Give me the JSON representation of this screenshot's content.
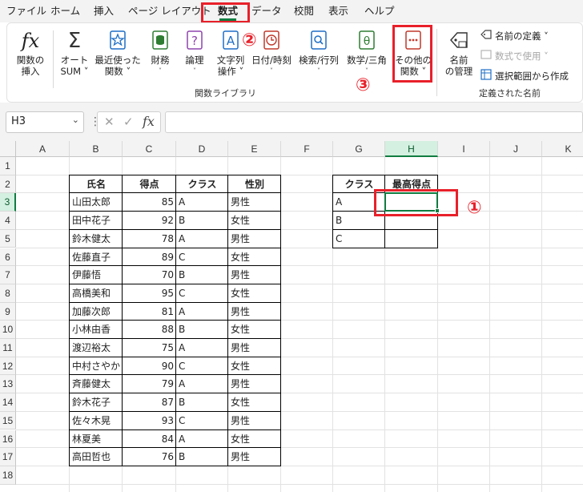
{
  "menu": {
    "tabs": [
      "ファイル",
      "ホーム",
      "挿入",
      "ページ レイアウト",
      "数式",
      "データ",
      "校閲",
      "表示",
      "ヘルプ"
    ],
    "active": "数式"
  },
  "ribbon": {
    "groups": [
      {
        "label": "関数ライブラリ"
      },
      {
        "label": "定義された名前"
      }
    ],
    "buttons": [
      {
        "line1": "関数の",
        "line2": "挿入"
      },
      {
        "line1": "オート",
        "line2": "SUM ˅"
      },
      {
        "line1": "最近使った",
        "line2": "関数 ˅"
      },
      {
        "line1": "財務",
        "line2": "˅"
      },
      {
        "line1": "論理",
        "line2": "˅"
      },
      {
        "line1": "文字列",
        "line2": "操作 ˅"
      },
      {
        "line1": "日付/時刻",
        "line2": "˅"
      },
      {
        "line1": "検索/行列",
        "line2": "˅"
      },
      {
        "line1": "数学/三角",
        "line2": "˅"
      },
      {
        "line1": "その他の",
        "line2": "関数 ˅"
      },
      {
        "line1": "名前",
        "line2": "の管理"
      }
    ],
    "small_commands": [
      "名前の定義 ˅",
      "数式で使用 ˅",
      "選択範囲から作成"
    ]
  },
  "annotations": [
    "①",
    "②",
    "③"
  ],
  "formula_bar": {
    "name_box": "H3",
    "fx": "fx",
    "value": ""
  },
  "grid": {
    "columns": [
      "A",
      "B",
      "C",
      "D",
      "E",
      "F",
      "G",
      "H",
      "I",
      "J",
      "K"
    ],
    "rows": [
      "1",
      "2",
      "3",
      "4",
      "5",
      "6",
      "7",
      "8",
      "9",
      "10",
      "11",
      "12",
      "13",
      "14",
      "15",
      "16",
      "17",
      "18"
    ],
    "selected_cell": "H3"
  },
  "table1": {
    "headers": [
      "氏名",
      "得点",
      "クラス",
      "性別"
    ],
    "rows": [
      [
        "山田太郎",
        "85",
        "A",
        "男性"
      ],
      [
        "田中花子",
        "92",
        "B",
        "女性"
      ],
      [
        "鈴木健太",
        "78",
        "A",
        "男性"
      ],
      [
        "佐藤直子",
        "89",
        "C",
        "女性"
      ],
      [
        "伊藤悟",
        "70",
        "B",
        "男性"
      ],
      [
        "高橋美和",
        "95",
        "C",
        "女性"
      ],
      [
        "加藤次郎",
        "81",
        "A",
        "男性"
      ],
      [
        "小林由香",
        "88",
        "B",
        "女性"
      ],
      [
        "渡辺裕太",
        "75",
        "A",
        "男性"
      ],
      [
        "中村さやか",
        "90",
        "C",
        "女性"
      ],
      [
        "斉藤健太",
        "79",
        "A",
        "男性"
      ],
      [
        "鈴木花子",
        "87",
        "B",
        "女性"
      ],
      [
        "佐々木晃",
        "93",
        "C",
        "男性"
      ],
      [
        "林夏美",
        "84",
        "A",
        "女性"
      ],
      [
        "高田哲也",
        "76",
        "B",
        "男性"
      ]
    ]
  },
  "table2": {
    "headers": [
      "クラス",
      "最高得点"
    ],
    "rows": [
      [
        "A",
        ""
      ],
      [
        "B",
        ""
      ],
      [
        "C",
        ""
      ]
    ]
  },
  "colors": {
    "accent": "#107c41",
    "highlight": "#e8202a"
  }
}
